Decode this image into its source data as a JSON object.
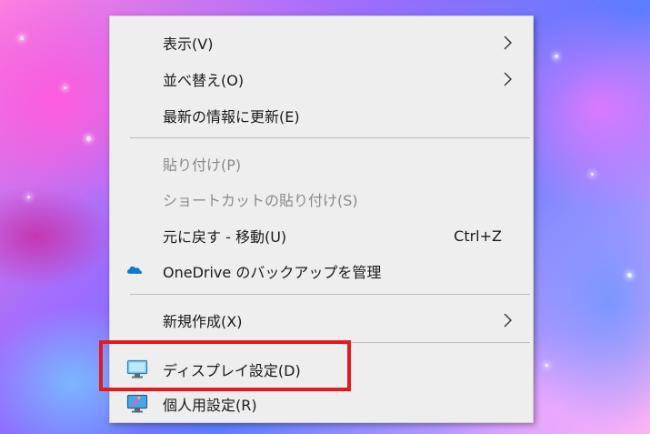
{
  "menu": {
    "view": {
      "label": "表示(V)",
      "icon": "chevron-right-icon"
    },
    "sort_by": {
      "label": "並べ替え(O)",
      "icon": "chevron-right-icon"
    },
    "refresh": {
      "label": "最新の情報に更新(E)"
    },
    "paste": {
      "label": "貼り付け(P)",
      "disabled": true
    },
    "paste_shortcut": {
      "label": "ショートカットの貼り付け(S)",
      "disabled": true
    },
    "undo_move": {
      "label": "元に戻す - 移動(U)",
      "shortcut": "Ctrl+Z"
    },
    "onedrive": {
      "label": "OneDrive のバックアップを管理",
      "icon": "onedrive-cloud-icon"
    },
    "new": {
      "label": "新規作成(X)",
      "icon": "chevron-right-icon"
    },
    "display_settings": {
      "label": "ディスプレイ設定(D)",
      "icon": "monitor-icon"
    },
    "personalize": {
      "label": "個人用設定(R)",
      "icon": "personalize-icon"
    }
  },
  "highlight": {
    "target": "display_settings",
    "color": "#e41a1a"
  },
  "colors": {
    "menu_background": "#eeeeee",
    "text": "#1a1a1a",
    "disabled_text": "#8a8a8a",
    "onedrive_blue": "#0f78d4"
  }
}
